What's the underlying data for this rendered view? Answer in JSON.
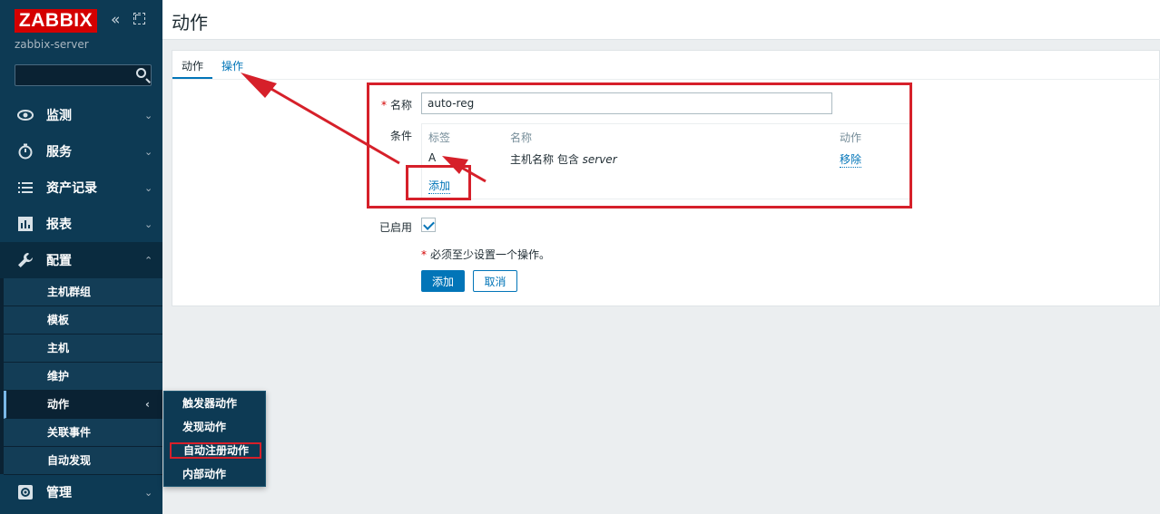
{
  "sidebar": {
    "logo": "ZABBIX",
    "collapse_icon": "«",
    "server_name": "zabbix-server",
    "search_placeholder": "",
    "nav": [
      {
        "label": "监测",
        "icon": "eye-icon"
      },
      {
        "label": "服务",
        "icon": "stopwatch-icon"
      },
      {
        "label": "资产记录",
        "icon": "list-icon"
      },
      {
        "label": "报表",
        "icon": "chart-icon"
      },
      {
        "label": "配置",
        "icon": "wrench-icon"
      },
      {
        "label": "管理",
        "icon": "gear-icon"
      }
    ],
    "config_submenu": [
      "主机群组",
      "模板",
      "主机",
      "维护",
      "动作",
      "关联事件",
      "自动发现"
    ],
    "actions_flyout": [
      "触发器动作",
      "发现动作",
      "自动注册动作",
      "内部动作"
    ]
  },
  "page": {
    "title": "动作",
    "tabs": [
      "动作",
      "操作"
    ]
  },
  "form": {
    "name_label": "名称",
    "name_value": "auto-reg",
    "conditions_label": "条件",
    "conditions": {
      "headers": [
        "标签",
        "名称",
        "动作"
      ],
      "rows": [
        {
          "tag": "A",
          "name_prefix": "主机名称 包含 ",
          "name_value": "server",
          "action": "移除"
        }
      ],
      "add_link": "添加"
    },
    "enabled_label": "已启用",
    "enabled": true,
    "warning": "必须至少设置一个操作。",
    "add_button": "添加",
    "cancel_button": "取消"
  },
  "colors": {
    "sidebar": "#0d3a54",
    "accent": "#0275b8",
    "highlight": "#d6202a",
    "logo": "#d40000"
  }
}
